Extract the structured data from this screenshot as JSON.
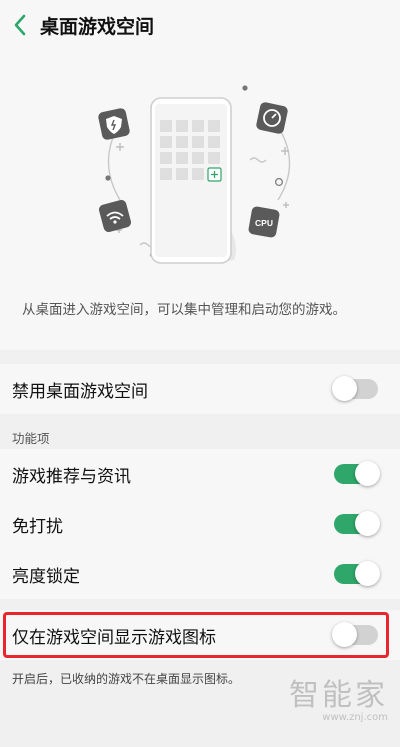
{
  "header": {
    "title": "桌面游戏空间"
  },
  "hero": {
    "description": "从桌面进入游戏空间，可以集中管理和启动您的游戏。",
    "cpu_label": "CPU"
  },
  "rows": {
    "disable_desktop": {
      "label": "禁用桌面游戏空间",
      "enabled": false
    },
    "section_title": "功能项",
    "recommend": {
      "label": "游戏推荐与资讯",
      "enabled": true
    },
    "dnd": {
      "label": "免打扰",
      "enabled": true
    },
    "brightness": {
      "label": "亮度锁定",
      "enabled": true
    },
    "icon_only": {
      "label": "仅在游戏空间显示游戏图标",
      "enabled": false
    }
  },
  "footnote": "开启后，已收纳的游戏不在桌面显示图标。",
  "watermark": {
    "text": "智能家",
    "domain": "www.znj.com"
  },
  "colors": {
    "toggle_on": "#2fa66a",
    "toggle_off": "#d2d2d2",
    "highlight": "#e8262b",
    "back_arrow": "#2fa66a"
  }
}
